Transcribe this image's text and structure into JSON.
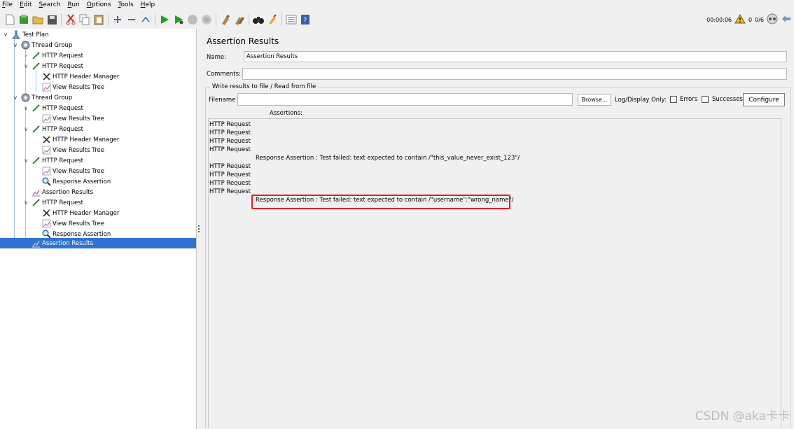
{
  "menu": [
    "File",
    "Edit",
    "Search",
    "Run",
    "Options",
    "Tools",
    "Help"
  ],
  "status": {
    "elapsed": "00:00:06",
    "warnings": "0",
    "threads": "0/6"
  },
  "tree": [
    {
      "label": "Test Plan",
      "icon": "test-plan-icon"
    },
    {
      "label": "Thread Group",
      "icon": "thread-group-gear-icon"
    },
    {
      "label": "HTTP Request",
      "icon": "http-request-pipette-icon"
    },
    {
      "label": "HTTP Request",
      "icon": "http-request-pipette-icon"
    },
    {
      "label": "HTTP Header Manager",
      "icon": "header-manager-scissors-icon"
    },
    {
      "label": "View Results Tree",
      "icon": "view-results-tree-icon"
    },
    {
      "label": "Thread Group",
      "icon": "thread-group-gear-icon"
    },
    {
      "label": "HTTP Request",
      "icon": "http-request-pipette-icon"
    },
    {
      "label": "View Results Tree",
      "icon": "view-results-tree-icon"
    },
    {
      "label": "HTTP Request",
      "icon": "http-request-pipette-icon"
    },
    {
      "label": "HTTP Header Manager",
      "icon": "header-manager-scissors-icon"
    },
    {
      "label": "View Results Tree",
      "icon": "view-results-tree-icon"
    },
    {
      "label": "HTTP Request",
      "icon": "http-request-pipette-icon"
    },
    {
      "label": "View Results Tree",
      "icon": "view-results-tree-icon"
    },
    {
      "label": "Response Assertion",
      "icon": "response-assertion-magnifier-icon"
    },
    {
      "label": "Assertion Results",
      "icon": "assertion-results-chart-icon"
    },
    {
      "label": "HTTP Request",
      "icon": "http-request-pipette-icon"
    },
    {
      "label": "HTTP Header Manager",
      "icon": "header-manager-scissors-icon"
    },
    {
      "label": "View Results Tree",
      "icon": "view-results-tree-icon"
    },
    {
      "label": "Response Assertion",
      "icon": "response-assertion-magnifier-icon"
    },
    {
      "label": "Assertion Results",
      "icon": "assertion-results-chart-icon"
    }
  ],
  "panel": {
    "title": "Assertion Results",
    "name_label": "Name:",
    "name_value": "Assertion Results",
    "comments_label": "Comments:",
    "comments_value": "",
    "file_group_title": "Write results to file / Read from file",
    "filename_label": "Filename",
    "filename_value": "",
    "browse_label": "Browse...",
    "log_display_label": "Log/Display Only:",
    "errors_label": "Errors",
    "successes_label": "Successes",
    "configure_label": "Configure",
    "assertions_label": "Assertions:"
  },
  "results": [
    "HTTP Request",
    "HTTP Request",
    "HTTP Request",
    "HTTP Request",
    "Response Assertion : Test failed: text expected to contain /\"this_value_never_exist_123\"/",
    "HTTP Request",
    "HTTP Request",
    "HTTP Request",
    "HTTP Request",
    "Response Assertion : Test failed: text expected to contain /\"username\":\"wrong_name\"/"
  ],
  "watermark": "CSDN @aka卡卡",
  "colors": {
    "selection": "#2f74d0",
    "highlight_border": "#e02020",
    "tree_line": "#a0c8e8"
  }
}
